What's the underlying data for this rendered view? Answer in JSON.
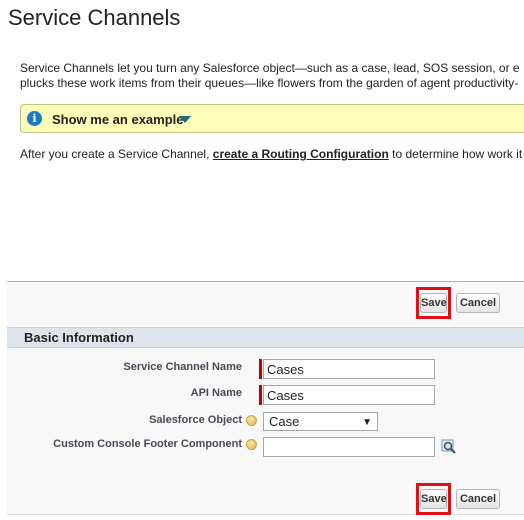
{
  "header": {
    "title": "Service Channels"
  },
  "intro": {
    "line1": "Service Channels let you turn any Salesforce object—such as a case, lead, SOS session, or e",
    "line2": "plucks these work items from their queues—like flowers from the garden of agent productivity-"
  },
  "example": {
    "label": "Show me an example",
    "icon_name": "info-icon",
    "caret_icon": "caret-down-icon"
  },
  "after": {
    "prefix": "After you create a Service Channel, ",
    "link": "create a Routing Configuration",
    "suffix": " to determine how work it"
  },
  "buttons": {
    "save": "Save",
    "cancel": "Cancel"
  },
  "section": {
    "title": "Basic Information"
  },
  "fields": {
    "service_channel_name": {
      "label": "Service Channel Name",
      "value": "Cases"
    },
    "api_name": {
      "label": "API Name",
      "value": "Cases"
    },
    "salesforce_object": {
      "label": "Salesforce Object",
      "value": "Case"
    },
    "custom_console_footer": {
      "label": "Custom Console Footer Component",
      "value": ""
    }
  },
  "colors": {
    "highlight": "#e0101a",
    "required": "#c00000",
    "info_box": "#fefdb9",
    "section_bg": "#dde4ec"
  }
}
